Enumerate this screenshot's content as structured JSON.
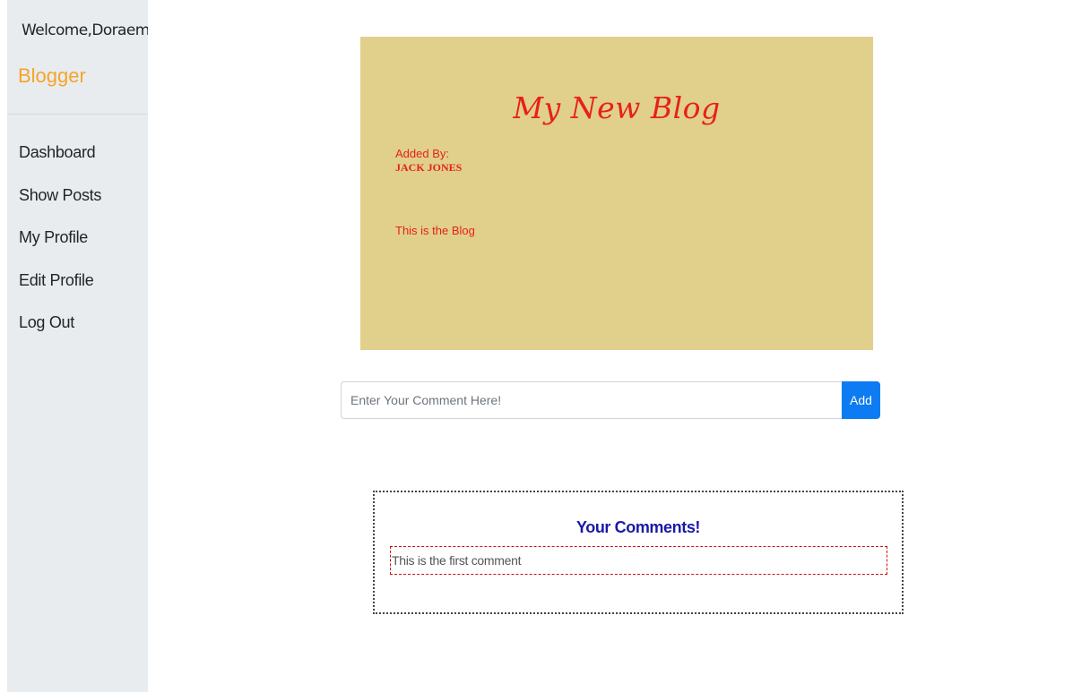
{
  "sidebar": {
    "welcome": "Welcome,Doraemon",
    "brand": "Blogger",
    "nav": [
      {
        "label": "Dashboard"
      },
      {
        "label": "Show Posts"
      },
      {
        "label": "My Profile"
      },
      {
        "label": "Edit Profile"
      },
      {
        "label": "Log Out"
      }
    ]
  },
  "blog": {
    "title": "My New Blog",
    "added_by_label": "Added By:",
    "author": "JACK JONES",
    "body": "This is the Blog",
    "card_color": "#e0d08b",
    "text_color": "#e8201a"
  },
  "comment_form": {
    "placeholder": "Enter Your Comment Here!",
    "value": "",
    "add_label": "Add",
    "accent": "#0d7bf2"
  },
  "comments": {
    "title": "Your Comments!",
    "items": [
      {
        "text": "This is the first comment"
      }
    ]
  }
}
